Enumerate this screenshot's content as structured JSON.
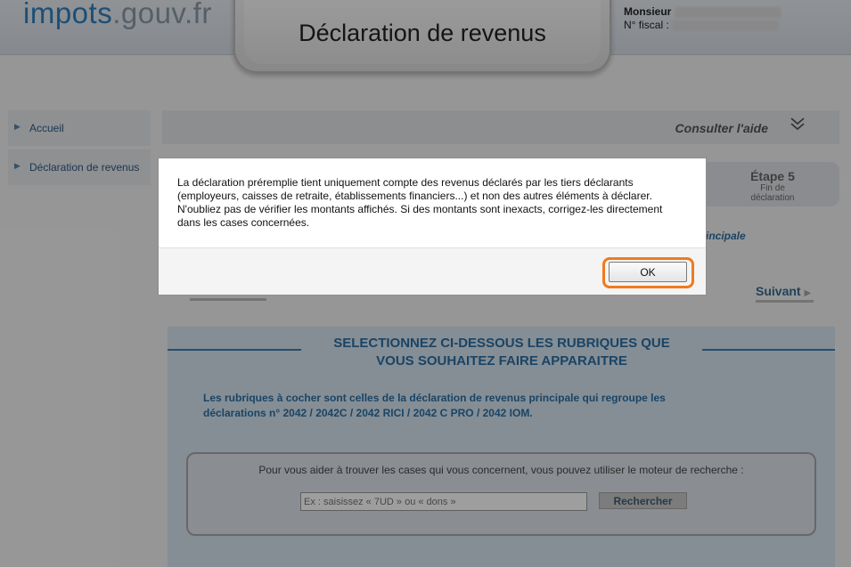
{
  "header": {
    "logo_part1": "impots",
    "logo_part2": ".gouv.fr",
    "title": "Déclaration de revenus",
    "user_label": "Monsieur",
    "fiscal_label": "N° fiscal :"
  },
  "sidebar": {
    "items": [
      {
        "label": "Accueil"
      },
      {
        "label": "Déclaration de revenus"
      }
    ]
  },
  "help": {
    "label": "Consulter l'aide",
    "icon": "double-chevron-down-icon"
  },
  "steps": {
    "current_title": "Étape 5",
    "current_sub1": "Fin de",
    "current_sub2": "déclaration",
    "partial_text": "incipale"
  },
  "nav": {
    "next_label": "Suivant"
  },
  "rubriques": {
    "title_line1": "SELECTIONNEZ CI-DESSOUS LES RUBRIQUES QUE",
    "title_line2": "VOUS SOUHAITEZ FAIRE APPARAITRE",
    "description_line1": "Les rubriques à cocher sont celles de la déclaration de revenus principale qui regroupe les",
    "description_line2": "déclarations n° 2042 / 2042C / 2042 RICI / 2042 C PRO / 2042 IOM.",
    "search_label": "Pour vous aider à trouver les cases qui vous concernent, vous pouvez utiliser le moteur de recherche :",
    "search_placeholder": "Ex : saisissez « 7UD » ou « dons »",
    "search_button": "Rechercher"
  },
  "modal": {
    "line1": "La déclaration préremplie tient uniquement compte des revenus déclarés par les tiers déclarants",
    "line2": "(employeurs, caisses de retraite, établissements financiers...) et non des autres éléments à déclarer.",
    "line3": "N'oubliez pas de vérifier les montants affichés. Si des montants sont inexacts, corrigez-les directement",
    "line4": "dans les cases concernées.",
    "ok_label": "OK"
  },
  "colors": {
    "brand_blue": "#2f7fc0",
    "title_blue": "#2b6fa4",
    "highlight_orange": "#f07a1f"
  }
}
